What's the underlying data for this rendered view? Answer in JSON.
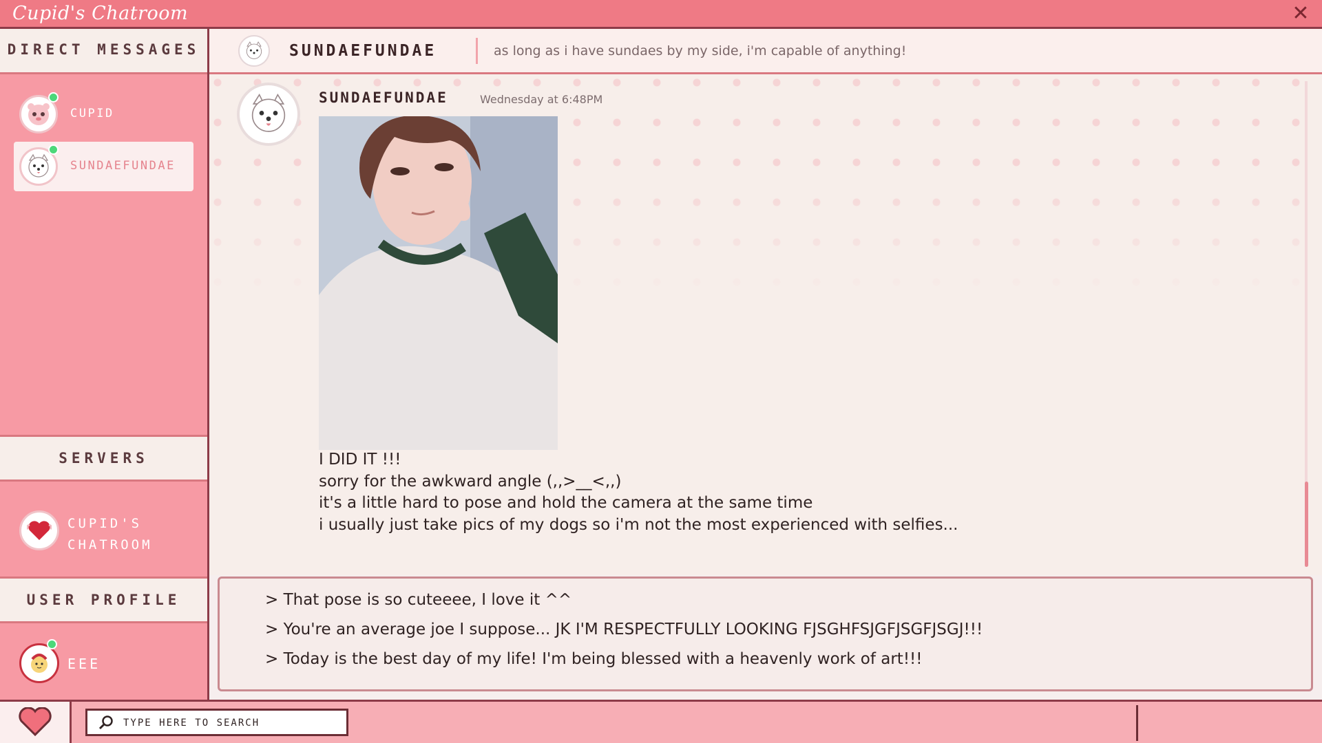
{
  "app": {
    "title": "Cupid's Chatroom",
    "close_icon": "close-icon"
  },
  "sidebar": {
    "dm_header": "DIRECT MESSAGES",
    "dms": [
      {
        "label": "CUPID",
        "avatar_icon": "cupid-avatar-icon",
        "online": true,
        "active": false
      },
      {
        "label": "SUNDAEFUNDAE",
        "avatar_icon": "dog-avatar-icon",
        "online": true,
        "active": true
      }
    ],
    "servers_header": "SERVERS",
    "servers": [
      {
        "label": "CUPID'S CHATROOM",
        "avatar_icon": "heart-server-icon"
      }
    ],
    "profile_header": "USER PROFILE",
    "profile": {
      "label": "EEE",
      "avatar_icon": "user-avatar-icon",
      "online": true
    }
  },
  "channel": {
    "name": "SUNDAEFUNDAE",
    "status": "as long as i have sundaes by my side, i'm capable of anything!"
  },
  "message": {
    "author": "SUNDAEFUNDAE",
    "time": "Wednesday at 6:48PM",
    "image_alt": "selfie-photo",
    "lines": [
      "I DID IT !!!",
      "sorry for the awkward angle (,,>__<,,)",
      "it's a little hard to pose and hold the camera at the same time",
      "i usually just take pics of my dogs so i'm not the most experienced with selfies..."
    ]
  },
  "replies": [
    "> That pose is so cuteeee, I love it ^^",
    "> You're an average joe I suppose... JK I'M RESPECTFULLY LOOKING FJSGHFSJGFJSGFJSGJ!!!",
    "> Today is the best day of my life! I'm being blessed with a heavenly work of art!!!"
  ],
  "taskbar": {
    "search_placeholder": "TYPE HERE TO SEARCH",
    "start_icon": "heart-icon"
  },
  "colors": {
    "accent": "#ef7a85",
    "sidebar": "#f79aa4",
    "border": "#8d3b48",
    "online": "#4cd87a"
  }
}
